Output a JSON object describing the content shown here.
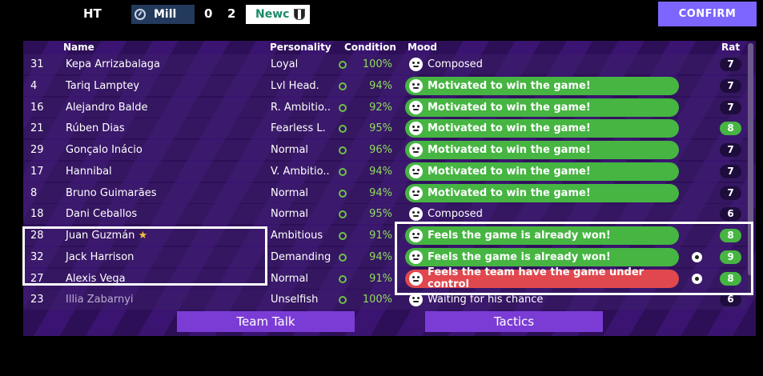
{
  "header": {
    "period": "HT",
    "home_team": "Mill",
    "home_score": "0",
    "away_score": "2",
    "away_team": "Newc",
    "confirm_label": "CONFIRM"
  },
  "table": {
    "columns": {
      "name": "Name",
      "personality": "Personality",
      "condition": "Condition",
      "mood": "Mood",
      "rating": "Rat"
    },
    "rows": [
      {
        "num": "31",
        "name": "Kepa Arrizabalaga",
        "personality": "Loyal",
        "condition": "100%",
        "mood": "Composed",
        "mood_style": "plain",
        "rating": "7",
        "rating_style": "dark",
        "ball": false
      },
      {
        "num": "4",
        "name": "Tariq Lamptey",
        "personality": "Lvl Head.",
        "condition": "94%",
        "mood": "Motivated to win the game!",
        "mood_style": "green",
        "rating": "7",
        "rating_style": "dark",
        "ball": false
      },
      {
        "num": "16",
        "name": "Alejandro Balde",
        "personality": "R. Ambitio..",
        "condition": "92%",
        "mood": "Motivated to win the game!",
        "mood_style": "green",
        "rating": "7",
        "rating_style": "dark",
        "ball": false
      },
      {
        "num": "21",
        "name": "Rúben Dias",
        "personality": "Fearless L.",
        "condition": "95%",
        "mood": "Motivated to win the game!",
        "mood_style": "green",
        "rating": "8",
        "rating_style": "green",
        "ball": false
      },
      {
        "num": "29",
        "name": "Gonçalo Inácio",
        "personality": "Normal",
        "condition": "96%",
        "mood": "Motivated to win the game!",
        "mood_style": "green",
        "rating": "7",
        "rating_style": "dark",
        "ball": false
      },
      {
        "num": "17",
        "name": "Hannibal",
        "personality": "V. Ambitio..",
        "condition": "94%",
        "mood": "Motivated to win the game!",
        "mood_style": "green",
        "rating": "7",
        "rating_style": "dark",
        "ball": false
      },
      {
        "num": "8",
        "name": "Bruno Guimarães",
        "personality": "Normal",
        "condition": "94%",
        "mood": "Motivated to win the game!",
        "mood_style": "green",
        "rating": "7",
        "rating_style": "dark",
        "ball": false
      },
      {
        "num": "18",
        "name": "Dani Ceballos",
        "personality": "Normal",
        "condition": "95%",
        "mood": "Composed",
        "mood_style": "plain",
        "rating": "6",
        "rating_style": "dark",
        "ball": false
      },
      {
        "num": "28",
        "name": "Juan Guzmán",
        "star": "★",
        "personality": "Ambitious",
        "condition": "91%",
        "mood": "Feels the game is already won!",
        "mood_style": "green",
        "rating": "8",
        "rating_style": "green",
        "ball": false
      },
      {
        "num": "32",
        "name": "Jack Harrison",
        "personality": "Demanding",
        "condition": "94%",
        "mood": "Feels the game is already won!",
        "mood_style": "green",
        "rating": "9",
        "rating_style": "green",
        "ball": true
      },
      {
        "num": "27",
        "name": "Alexis Vega",
        "personality": "Normal",
        "condition": "91%",
        "mood": "Feels the team have the game under control",
        "mood_style": "red",
        "rating": "8",
        "rating_style": "green",
        "ball": true
      },
      {
        "num": "23",
        "name": "Illia Zabarnyi",
        "personality": "Unselfish",
        "condition": "100%",
        "mood": "Waiting for his chance",
        "mood_style": "plain",
        "rating": "6",
        "rating_style": "dark",
        "ball": false,
        "faded": true
      }
    ]
  },
  "buttons": {
    "team_talk": "Team Talk",
    "tactics": "Tactics"
  },
  "colors": {
    "mood_green": "#46b542",
    "mood_red": "#e0484e",
    "confirm": "#7c66ff",
    "button_purple": "#7b3cd6",
    "condition_green": "#8fdc5c"
  }
}
